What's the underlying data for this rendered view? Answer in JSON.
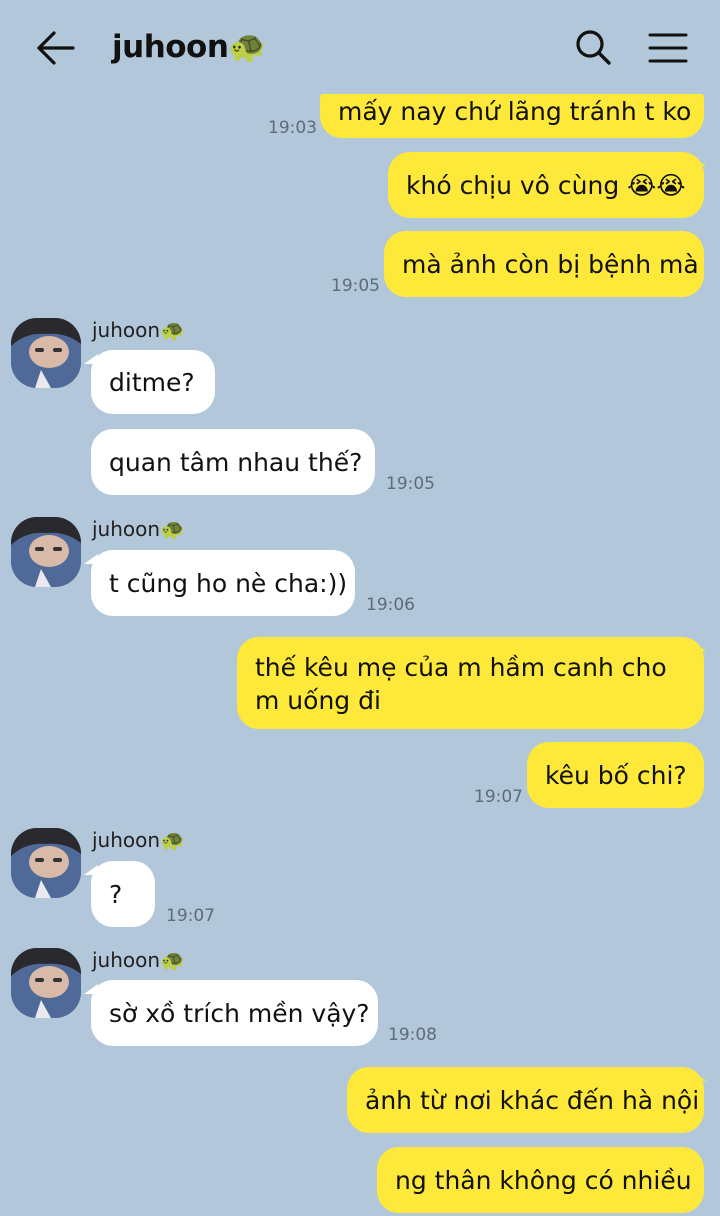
{
  "header": {
    "title": "juhoon🐢",
    "back_icon": "arrow-left-icon",
    "search_icon": "search-icon",
    "menu_icon": "hamburger-menu-icon"
  },
  "colors": {
    "background": "#b2c7da",
    "my_bubble": "#fee93a",
    "their_bubble": "#ffffff"
  },
  "messages": [
    {
      "from": "me",
      "text": "mấy nay chứ lãng tránh t ko",
      "time": "19:03"
    },
    {
      "from": "me",
      "text": "khó chịu vô cùng 😭😭",
      "time": ""
    },
    {
      "from": "me",
      "text": "mà ảnh còn bị bệnh mà",
      "time": "19:05"
    },
    {
      "from": "juhoon",
      "sender": "juhoon🐢",
      "text": "ditme?",
      "time": ""
    },
    {
      "from": "juhoon",
      "text": "quan tâm nhau thế?",
      "time": "19:05"
    },
    {
      "from": "juhoon",
      "sender": "juhoon🐢",
      "text": "t cũng ho nè cha:))",
      "time": "19:06"
    },
    {
      "from": "me",
      "text": "thế kêu mẹ của m hầm canh cho m uống đi",
      "time": ""
    },
    {
      "from": "me",
      "text": "kêu bố chi?",
      "time": "19:07"
    },
    {
      "from": "juhoon",
      "sender": "juhoon🐢",
      "text": "?",
      "time": "19:07"
    },
    {
      "from": "juhoon",
      "sender": "juhoon🐢",
      "text": "sờ xồ trích mền vậy?",
      "time": "19:08"
    },
    {
      "from": "me",
      "text": "ảnh từ nơi khác đến hà nội",
      "time": ""
    },
    {
      "from": "me",
      "text": "ng thân không có nhiều",
      "time": ""
    }
  ]
}
